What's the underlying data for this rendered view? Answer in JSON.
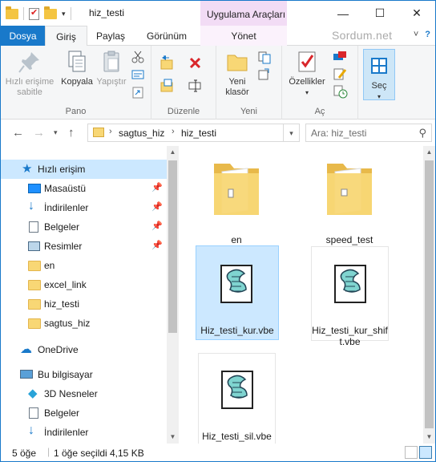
{
  "window": {
    "title": "hiz_testi",
    "context_tab_group": "Uygulama Araçları",
    "controls": {
      "minimize": "—",
      "maximize": "☐",
      "close": "✕"
    }
  },
  "ribbon_tabs": {
    "file": "Dosya",
    "home": "Giriş",
    "share": "Paylaş",
    "view": "Görünüm",
    "manage": "Yönet",
    "brand": "Sordum.net"
  },
  "ribbon": {
    "pano": {
      "label": "Pano",
      "pin": "Hızlı erişime sabitle",
      "pin_line1": "Hızlı erişime",
      "pin_line2": "sabitle",
      "copy": "Kopyala",
      "paste": "Yapıştır"
    },
    "duzenle": {
      "label": "Düzenle"
    },
    "yeni": {
      "label": "Yeni",
      "new_folder_line1": "Yeni",
      "new_folder_line2": "klasör"
    },
    "ac": {
      "label": "Aç",
      "properties": "Özellikler"
    },
    "sec": {
      "label": "Seç",
      "select": "Seç"
    }
  },
  "address": {
    "crumbs": [
      "sagtus_hiz",
      "hiz_testi"
    ],
    "search_placeholder": "Ara: hiz_testi"
  },
  "nav": {
    "quick_access": "Hızlı erişim",
    "items": [
      {
        "label": "Masaüstü",
        "pinned": true
      },
      {
        "label": "İndirilenler",
        "pinned": true
      },
      {
        "label": "Belgeler",
        "pinned": true
      },
      {
        "label": "Resimler",
        "pinned": true
      },
      {
        "label": "en",
        "pinned": false
      },
      {
        "label": "excel_link",
        "pinned": false
      },
      {
        "label": "hiz_testi",
        "pinned": false
      },
      {
        "label": "sagtus_hiz",
        "pinned": false
      }
    ],
    "onedrive": "OneDrive",
    "this_pc": "Bu bilgisayar",
    "pc_items": [
      "3D Nesneler",
      "Belgeler",
      "İndirilenler"
    ]
  },
  "files": [
    {
      "name": "en",
      "type": "folder",
      "selected": false
    },
    {
      "name": "speed_test",
      "type": "folder",
      "selected": false
    },
    {
      "name": "Hiz_testi_kur.vbe",
      "type": "script",
      "selected": true
    },
    {
      "name_line1": "Hiz_testi_kur_shif",
      "name_line2": "t.vbe",
      "type": "script",
      "selected": false
    },
    {
      "name": "Hiz_testi_sil.vbe",
      "type": "script",
      "selected": false
    }
  ],
  "status": {
    "count": "5 öğe",
    "selection": "1 öğe seçildi",
    "size": "4,15 KB"
  },
  "colors": {
    "accent": "#1979ca",
    "selection": "#cce8ff",
    "context_tab": "#f2dcf5"
  }
}
